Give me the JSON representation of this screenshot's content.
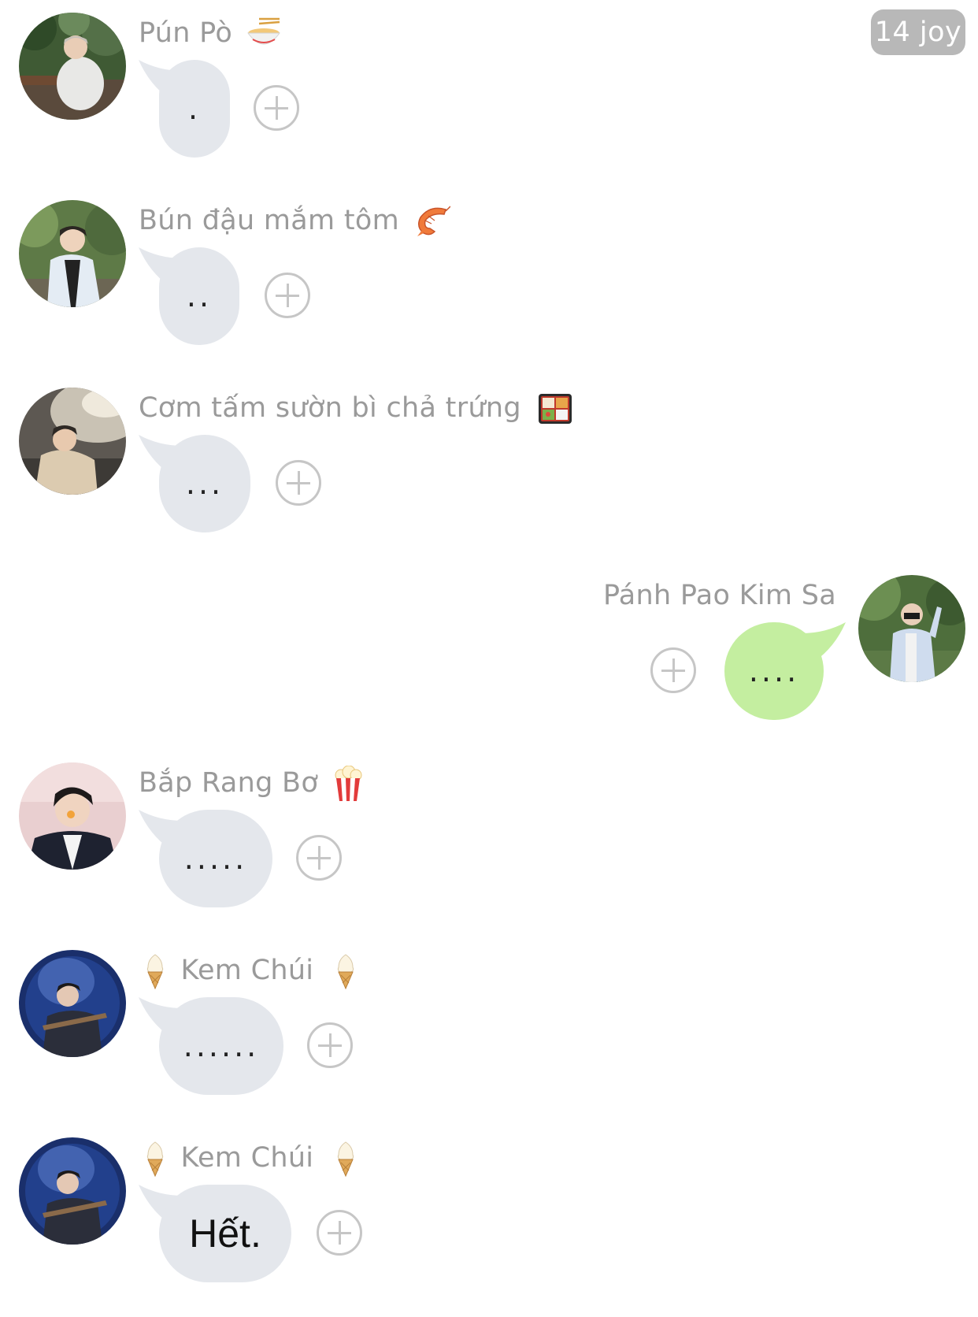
{
  "header": {
    "badge": "14 joy"
  },
  "colors": {
    "bubble_incoming": "#e4e7ec",
    "bubble_outgoing": "#c4eea0",
    "name_text": "#9a9a9a",
    "badge_bg": "#b8b8b8"
  },
  "messages": [
    {
      "sender": "Pún Pò",
      "emoji_after": "ramen-bowl-icon",
      "text": ".",
      "side": "left"
    },
    {
      "sender": "Bún đậu mắm tôm",
      "emoji_after": "shrimp-icon",
      "text": "..",
      "side": "left"
    },
    {
      "sender": "Cơm tấm sườn bì chả trứng",
      "emoji_after": "bento-box-icon",
      "text": "...",
      "side": "left"
    },
    {
      "sender": "Pánh Pao Kim Sa",
      "text": "....",
      "side": "right"
    },
    {
      "sender": "Bắp Rang Bơ",
      "emoji_after": "popcorn-icon",
      "text": ".....",
      "side": "left"
    },
    {
      "sender": "Kem Chúi",
      "emoji_before": "ice-cream-icon",
      "emoji_after": "ice-cream-icon",
      "text": "......",
      "side": "left"
    },
    {
      "sender": "Kem Chúi",
      "emoji_before": "ice-cream-icon",
      "emoji_after": "ice-cream-icon",
      "text": "Hết.",
      "side": "left"
    }
  ]
}
